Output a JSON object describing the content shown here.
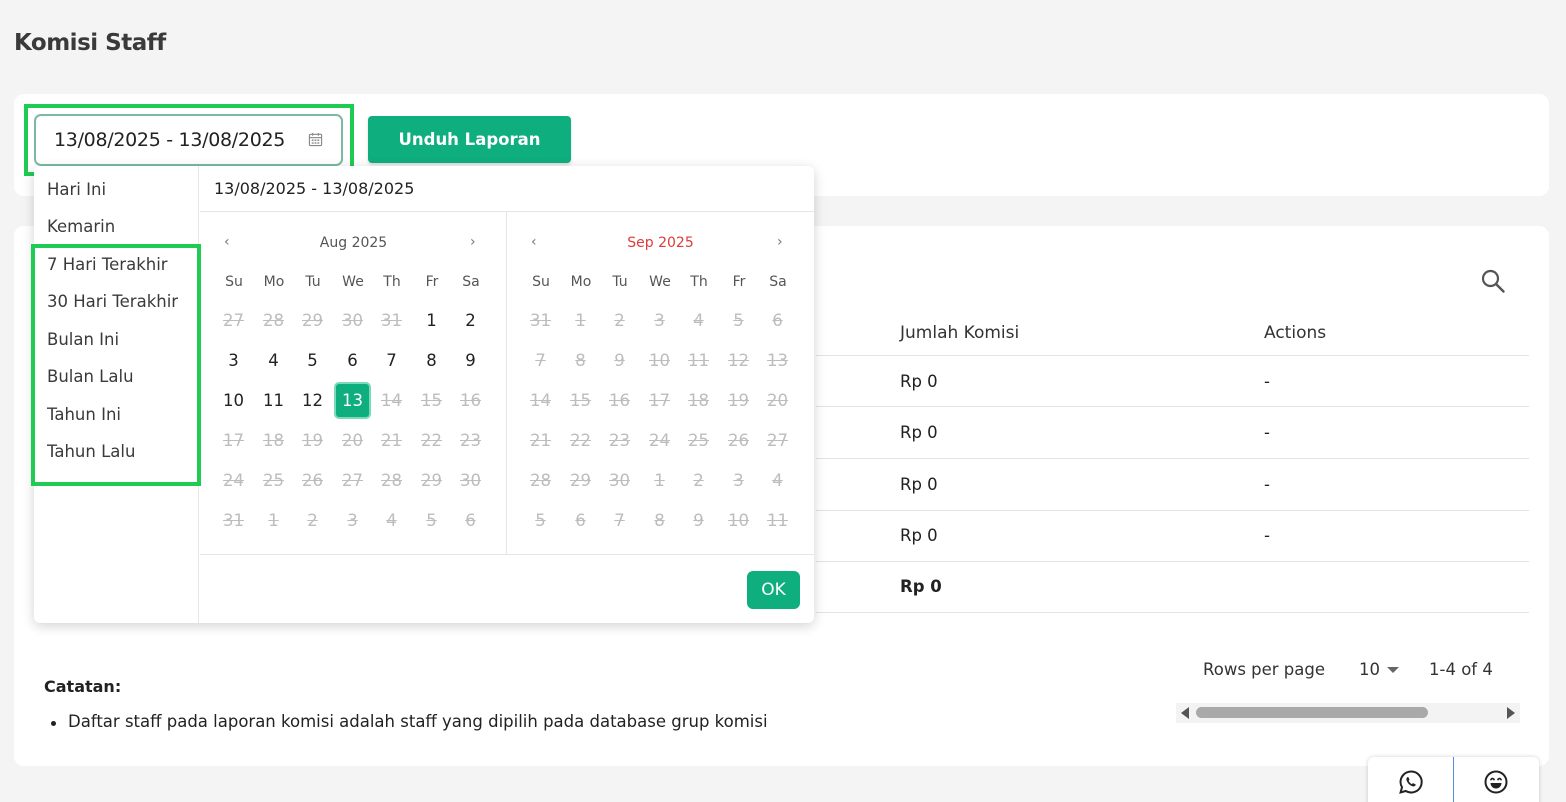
{
  "page": {
    "title": "Komisi Staff"
  },
  "filter": {
    "date_range": "13/08/2025 - 13/08/2025",
    "download_label": "Unduh Laporan"
  },
  "table": {
    "columns": {
      "commission": "Jumlah Komisi",
      "actions": "Actions"
    },
    "rows": [
      {
        "commission": "Rp 0",
        "actions": "-"
      },
      {
        "commission": "Rp 0",
        "actions": "-"
      },
      {
        "commission": "Rp 0",
        "actions": "-"
      },
      {
        "commission": "Rp 0",
        "actions": "-"
      }
    ],
    "total": "Rp 0"
  },
  "notes": {
    "title": "Catatan:",
    "items": [
      "Daftar staff pada laporan komisi adalah staff yang dipilih pada database grup komisi"
    ]
  },
  "pagination": {
    "rows_per_page_label": "Rows per page",
    "rows_per_page": "10",
    "range": "1-4 of 4"
  },
  "picker": {
    "header": "13/08/2025 - 13/08/2025",
    "ranges": [
      "Hari Ini",
      "Kemarin",
      "7 Hari Terakhir",
      "30 Hari Terakhir",
      "Bulan Ini",
      "Bulan Lalu",
      "Tahun Ini",
      "Tahun Lalu"
    ],
    "weekdays": [
      "Su",
      "Mo",
      "Tu",
      "We",
      "Th",
      "Fr",
      "Sa"
    ],
    "prev": "‹",
    "next": "›",
    "months": [
      {
        "title": "Aug 2025",
        "weeks": [
          [
            "27",
            "28",
            "29",
            "30",
            "31",
            "1",
            "2"
          ],
          [
            "3",
            "4",
            "5",
            "6",
            "7",
            "8",
            "9"
          ],
          [
            "10",
            "11",
            "12",
            "13",
            "14",
            "15",
            "16"
          ],
          [
            "17",
            "18",
            "19",
            "20",
            "21",
            "22",
            "23"
          ],
          [
            "24",
            "25",
            "26",
            "27",
            "28",
            "29",
            "30"
          ],
          [
            "31",
            "1",
            "2",
            "3",
            "4",
            "5",
            "6"
          ]
        ]
      },
      {
        "title": "Sep 2025",
        "weeks": [
          [
            "31",
            "1",
            "2",
            "3",
            "4",
            "5",
            "6"
          ],
          [
            "7",
            "8",
            "9",
            "10",
            "11",
            "12",
            "13"
          ],
          [
            "14",
            "15",
            "16",
            "17",
            "18",
            "19",
            "20"
          ],
          [
            "21",
            "22",
            "23",
            "24",
            "25",
            "26",
            "27"
          ],
          [
            "28",
            "29",
            "30",
            "1",
            "2",
            "3",
            "4"
          ],
          [
            "5",
            "6",
            "7",
            "8",
            "9",
            "10",
            "11"
          ]
        ]
      }
    ],
    "selected": "13",
    "ok_label": "OK"
  },
  "colors": {
    "primary": "#0fae7e",
    "highlight": "#1fcb52",
    "accent_month": "#e03a3a"
  },
  "icons": [
    "calendar-icon",
    "search-icon",
    "whatsapp-icon",
    "smiley-icon"
  ]
}
